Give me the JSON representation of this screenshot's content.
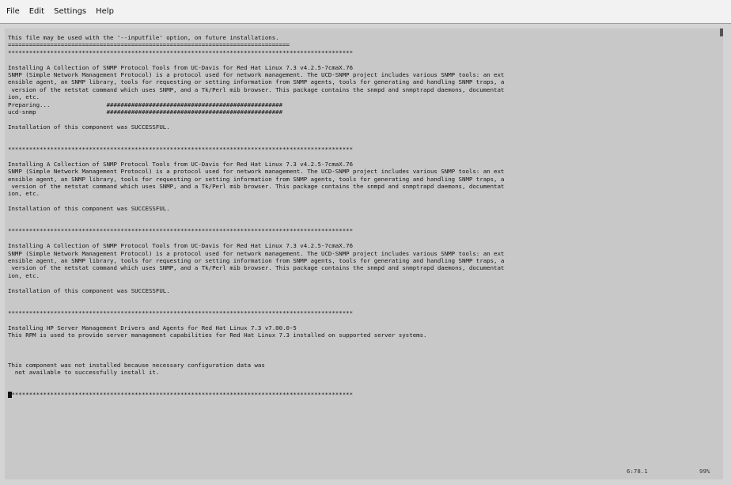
{
  "menu": {
    "items": [
      "File",
      "Edit",
      "Settings",
      "Help"
    ]
  },
  "terminal": {
    "lines": [
      "This file may be used with the '--inputfile' option, on future installations.",
      "================================================================================",
      "**************************************************************************************************",
      "",
      "Installing A Collection of SNMP Protocol Tools from UC-Davis for Red Hat Linux 7.3 v4.2.5-7cmaX.76",
      "SNMP (Simple Network Management Protocol) is a protocol used for network management. The UCD-SNMP project includes various SNMP tools: an ext",
      "ensible agent, an SNMP library, tools for requesting or setting information from SNMP agents, tools for generating and handling SNMP traps, a",
      " version of the netstat command which uses SNMP, and a Tk/Perl mib browser. This package contains the snmpd and snmptrapd daemons, documentat",
      "ion, etc.",
      "Preparing...                ##################################################",
      "ucd-snmp                    ##################################################",
      "",
      "Installation of this component was SUCCESSFUL.",
      "",
      "",
      "**************************************************************************************************",
      "",
      "Installing A Collection of SNMP Protocol Tools from UC-Davis for Red Hat Linux 7.3 v4.2.5-7cmaX.76",
      "SNMP (Simple Network Management Protocol) is a protocol used for network management. The UCD-SNMP project includes various SNMP tools: an ext",
      "ensible agent, an SNMP library, tools for requesting or setting information from SNMP agents, tools for generating and handling SNMP traps, a",
      " version of the netstat command which uses SNMP, and a Tk/Perl mib browser. This package contains the snmpd and snmptrapd daemons, documentat",
      "ion, etc.",
      "",
      "Installation of this component was SUCCESSFUL.",
      "",
      "",
      "**************************************************************************************************",
      "",
      "Installing A Collection of SNMP Protocol Tools from UC-Davis for Red Hat Linux 7.3 v4.2.5-7cmaX.76",
      "SNMP (Simple Network Management Protocol) is a protocol used for network management. The UCD-SNMP project includes various SNMP tools: an ext",
      "ensible agent, an SNMP library, tools for requesting or setting information from SNMP agents, tools for generating and handling SNMP traps, a",
      " version of the netstat command which uses SNMP, and a Tk/Perl mib browser. This package contains the snmpd and snmptrapd daemons, documentat",
      "ion, etc.",
      "",
      "Installation of this component was SUCCESSFUL.",
      "",
      "",
      "**************************************************************************************************",
      "",
      "Installing HP Server Management Drivers and Agents for Red Hat Linux 7.3 v7.00.0-5",
      "This RPM is used to provide server management capabilities for Red Hat Linux 7.3 installed on supported server systems.",
      "",
      "",
      "",
      "This component was not installed because necessary configuration data was",
      "  not available to successfully install it.",
      "",
      "",
      "**************************************************************************************************"
    ],
    "status_position": "6:78.1",
    "status_percent": "99%"
  }
}
